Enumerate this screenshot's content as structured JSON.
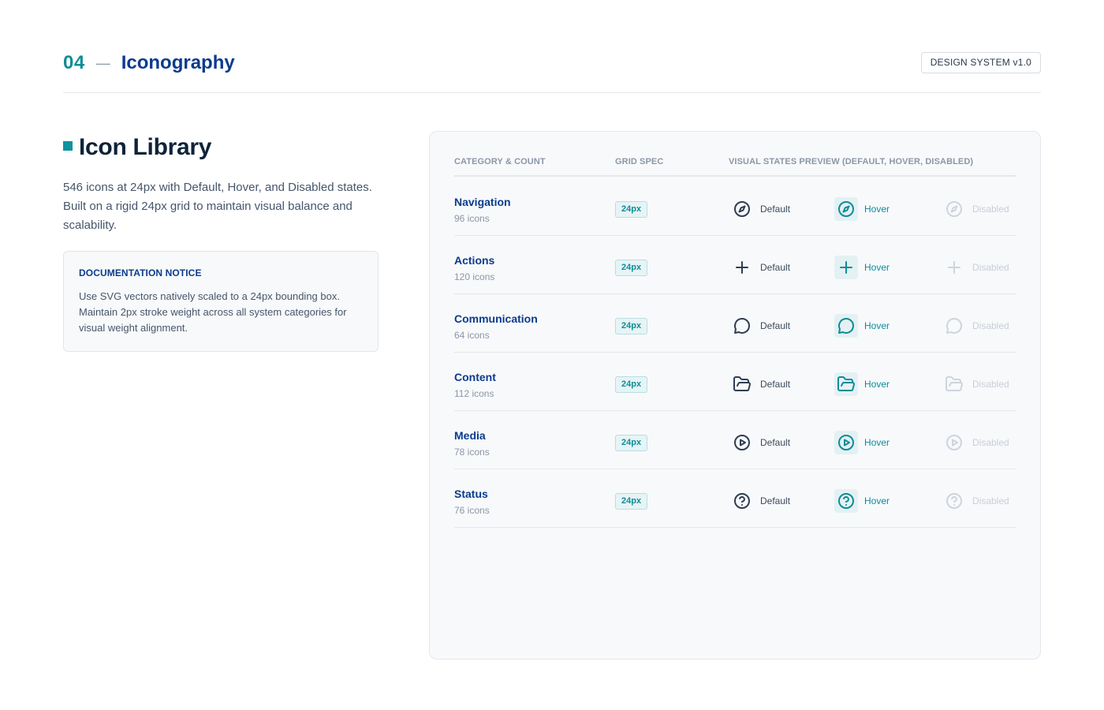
{
  "header": {
    "section_number": "04",
    "separator": "—",
    "section_title": "Iconography",
    "badge": "DESIGN SYSTEM v1.0"
  },
  "library": {
    "title": "Icon Library",
    "description": "546 icons at 24px with Default, Hover, and Disabled states. Built on a rigid 24px grid to maintain visual balance and scalability."
  },
  "notice": {
    "title": "DOCUMENTATION NOTICE",
    "body": "Use SVG vectors natively scaled to a 24px bounding box. Maintain 2px stroke weight across all system categories for visual weight alignment."
  },
  "table": {
    "headers": {
      "category": "CATEGORY & COUNT",
      "grid": "GRID SPEC",
      "visual": "VISUAL STATES PREVIEW (DEFAULT, HOVER, DISABLED)"
    },
    "state_labels": {
      "default": "Default",
      "hover": "Hover",
      "disabled": "Disabled"
    },
    "rows": [
      {
        "name": "Navigation",
        "count": "96 icons",
        "grid": "24px",
        "icon": "compass-icon"
      },
      {
        "name": "Actions",
        "count": "120 icons",
        "grid": "24px",
        "icon": "plus-icon"
      },
      {
        "name": "Communication",
        "count": "64 icons",
        "grid": "24px",
        "icon": "message-circle-icon"
      },
      {
        "name": "Content",
        "count": "112 icons",
        "grid": "24px",
        "icon": "folder-open-icon"
      },
      {
        "name": "Media",
        "count": "78 icons",
        "grid": "24px",
        "icon": "play-circle-icon"
      },
      {
        "name": "Status",
        "count": "76 icons",
        "grid": "24px",
        "icon": "help-circle-icon"
      }
    ]
  },
  "colors": {
    "accent": "#0e8c99",
    "brand": "#0b3b8c",
    "muted": "#8b97a6"
  }
}
